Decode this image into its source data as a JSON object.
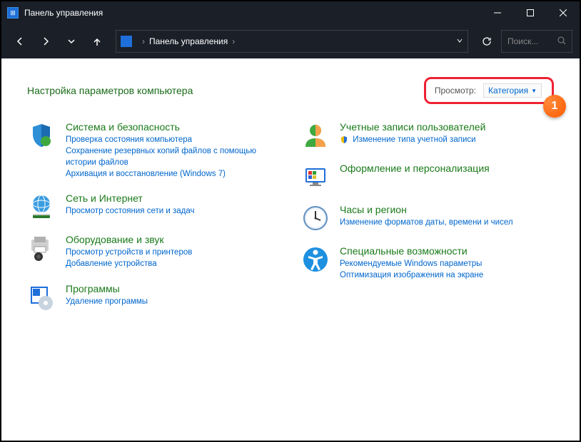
{
  "window": {
    "title": "Панель управления"
  },
  "address": {
    "root": "Панель управления"
  },
  "search": {
    "placeholder": "Поиск..."
  },
  "heading": "Настройка параметров компьютера",
  "view": {
    "label": "Просмотр:",
    "value": "Категория"
  },
  "callout": "1",
  "left": [
    {
      "title": "Система и безопасность",
      "links": [
        "Проверка состояния компьютера",
        "Сохранение резервных копий файлов с помощью истории файлов",
        "Архивация и восстановление (Windows 7)"
      ]
    },
    {
      "title": "Сеть и Интернет",
      "links": [
        "Просмотр состояния сети и задач"
      ]
    },
    {
      "title": "Оборудование и звук",
      "links": [
        "Просмотр устройств и принтеров",
        "Добавление устройства"
      ]
    },
    {
      "title": "Программы",
      "links": [
        "Удаление программы"
      ]
    }
  ],
  "right": [
    {
      "title": "Учетные записи пользователей",
      "links": [
        "Изменение типа учетной записи"
      ],
      "shield": true
    },
    {
      "title": "Оформление и персонализация",
      "links": []
    },
    {
      "title": "Часы и регион",
      "links": [
        "Изменение форматов даты, времени и чисел"
      ]
    },
    {
      "title": "Специальные возможности",
      "links": [
        "Рекомендуемые Windows параметры",
        "Оптимизация изображения на экране"
      ]
    }
  ]
}
